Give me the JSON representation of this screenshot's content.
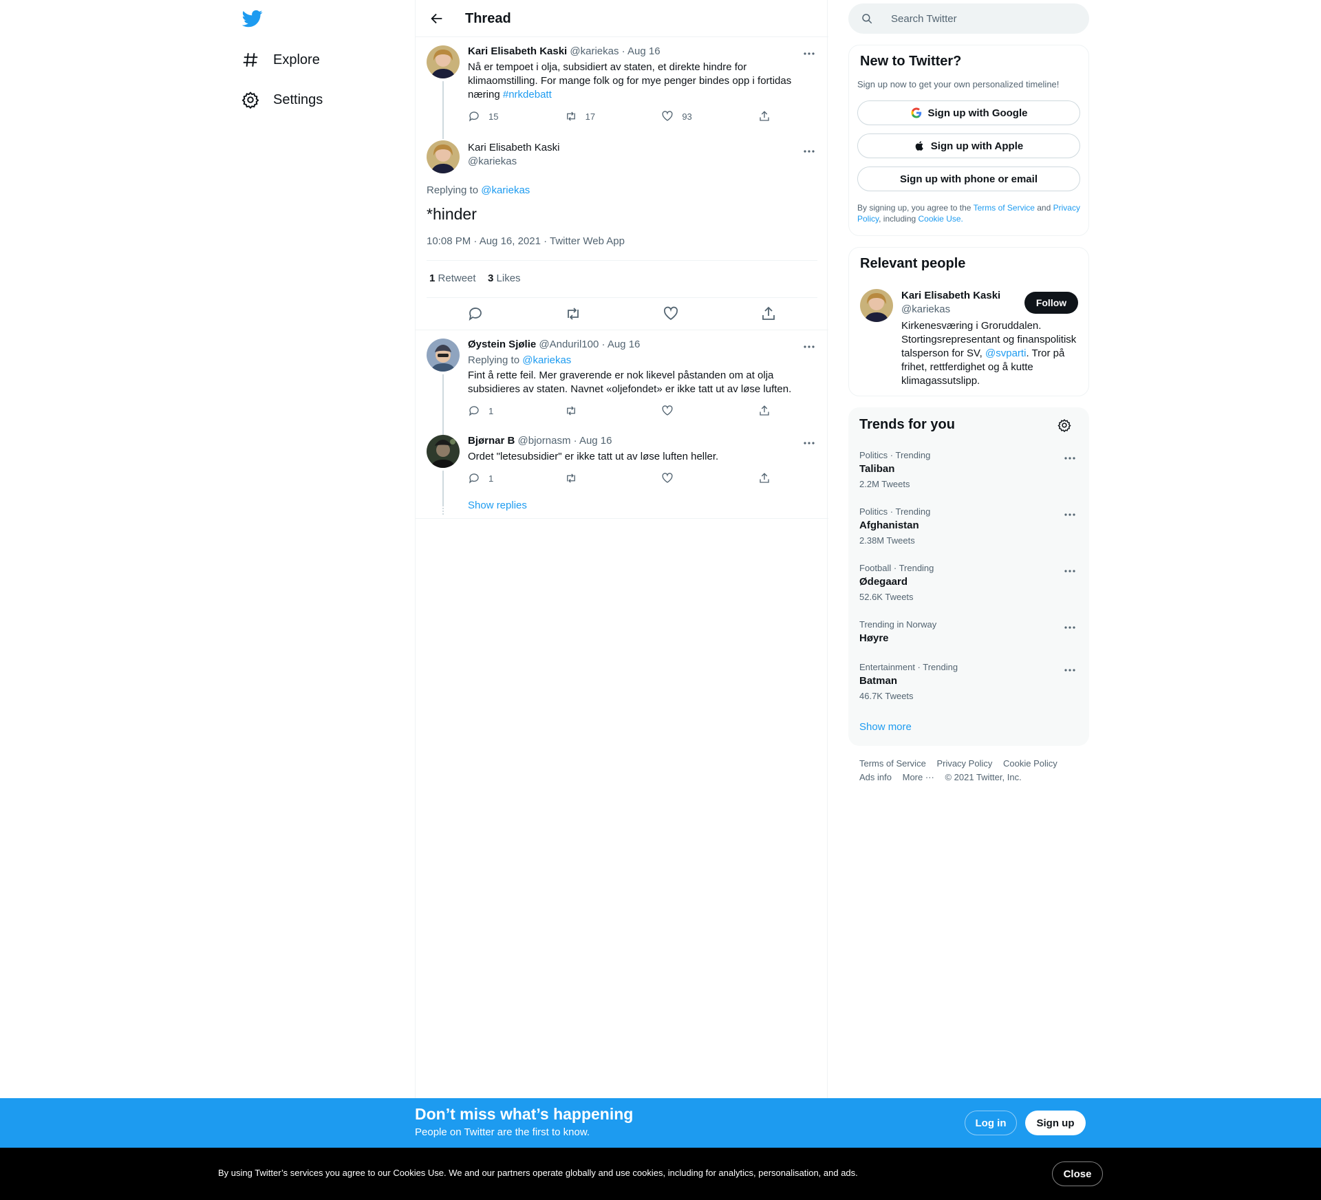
{
  "nav": {
    "explore": "Explore",
    "settings": "Settings"
  },
  "header": {
    "title": "Thread"
  },
  "tweets": [
    {
      "name": "Kari Elisabeth Kaski",
      "handle": "@kariekas",
      "date": "· Aug 16",
      "text_prefix": "Nå er tempoet i olja, subsidiert av staten, et direkte hindre for klimaomstilling. For mange folk og for mye penger bindes opp i fortidas næring ",
      "hashtag": "#nrkdebatt",
      "replies": "15",
      "retweets": "17",
      "likes": "93"
    },
    {
      "name": "Kari Elisabeth Kaski",
      "handle": "@kariekas",
      "replying_prefix": "Replying to ",
      "replying_to": "@kariekas",
      "text": "*hinder",
      "timestamp": "10:08 PM · Aug 16, 2021 · Twitter Web App",
      "retweet_count": "1",
      "retweet_label": "Retweet",
      "like_count": "3",
      "like_label": "Likes"
    },
    {
      "name": "Øystein Sjølie",
      "handle": "@Anduril100",
      "date": "· Aug 16",
      "replying_prefix": "Replying to ",
      "replying_to": "@kariekas",
      "text": "Fint å rette feil. Mer graverende er nok likevel påstanden om at olja subsidieres av staten. Navnet «oljefondet» er ikke tatt ut av løse luften.",
      "replies": "1"
    },
    {
      "name": "Bjørnar B",
      "handle": "@bjornasm",
      "date": "· Aug 16",
      "text": "Ordet \"letesubsidier\" er ikke tatt ut av løse luften heller.",
      "replies": "1"
    }
  ],
  "show_replies": "Show replies",
  "search": {
    "placeholder": "Search Twitter"
  },
  "signup": {
    "title": "New to Twitter?",
    "subtitle": "Sign up now to get your own personalized timeline!",
    "google": "Sign up with Google",
    "apple": "Sign up with Apple",
    "phone": "Sign up with phone or email",
    "legal_1": "By signing up, you agree to the ",
    "tos": "Terms of Service",
    "legal_2": " and ",
    "privacy": "Privacy Policy",
    "legal_3": ", including ",
    "cookie": "Cookie Use."
  },
  "relevant": {
    "title": "Relevant people",
    "name": "Kari Elisabeth Kaski",
    "handle": "@kariekas",
    "follow": "Follow",
    "bio_1": "Kirkenesværing i Groruddalen. Stortingsrepresentant og finanspolitisk talsperson for SV, ",
    "bio_mention": "@svparti",
    "bio_2": ". Tror på frihet, rettferdighet og å kutte klimagassutslipp."
  },
  "trends": {
    "title": "Trends for you",
    "items": [
      {
        "meta": "Politics · Trending",
        "name": "Taliban",
        "count": "2.2M Tweets"
      },
      {
        "meta": "Politics · Trending",
        "name": "Afghanistan",
        "count": "2.38M Tweets"
      },
      {
        "meta": "Football · Trending",
        "name": "Ødegaard",
        "count": "52.6K Tweets"
      },
      {
        "meta": "Trending in Norway",
        "name": "Høyre",
        "count": ""
      },
      {
        "meta": "Entertainment · Trending",
        "name": "Batman",
        "count": "46.7K Tweets"
      }
    ],
    "show_more": "Show more"
  },
  "footer": {
    "terms": "Terms of Service",
    "privacy": "Privacy Policy",
    "cookie": "Cookie Policy",
    "ads": "Ads info",
    "more": "More ···",
    "copyright": "© 2021 Twitter, Inc."
  },
  "bluebar": {
    "title": "Don’t miss what’s happening",
    "subtitle": "People on Twitter are the first to know.",
    "login": "Log in",
    "signup": "Sign up"
  },
  "cookiebar": {
    "text": "By using Twitter’s services you agree to our Cookies Use. We and our partners operate globally and use cookies, including for analytics, personalisation, and ads.",
    "close": "Close"
  },
  "colors": {
    "accent": "#1d9bf0",
    "text": "#0f1419",
    "muted": "#536471"
  }
}
